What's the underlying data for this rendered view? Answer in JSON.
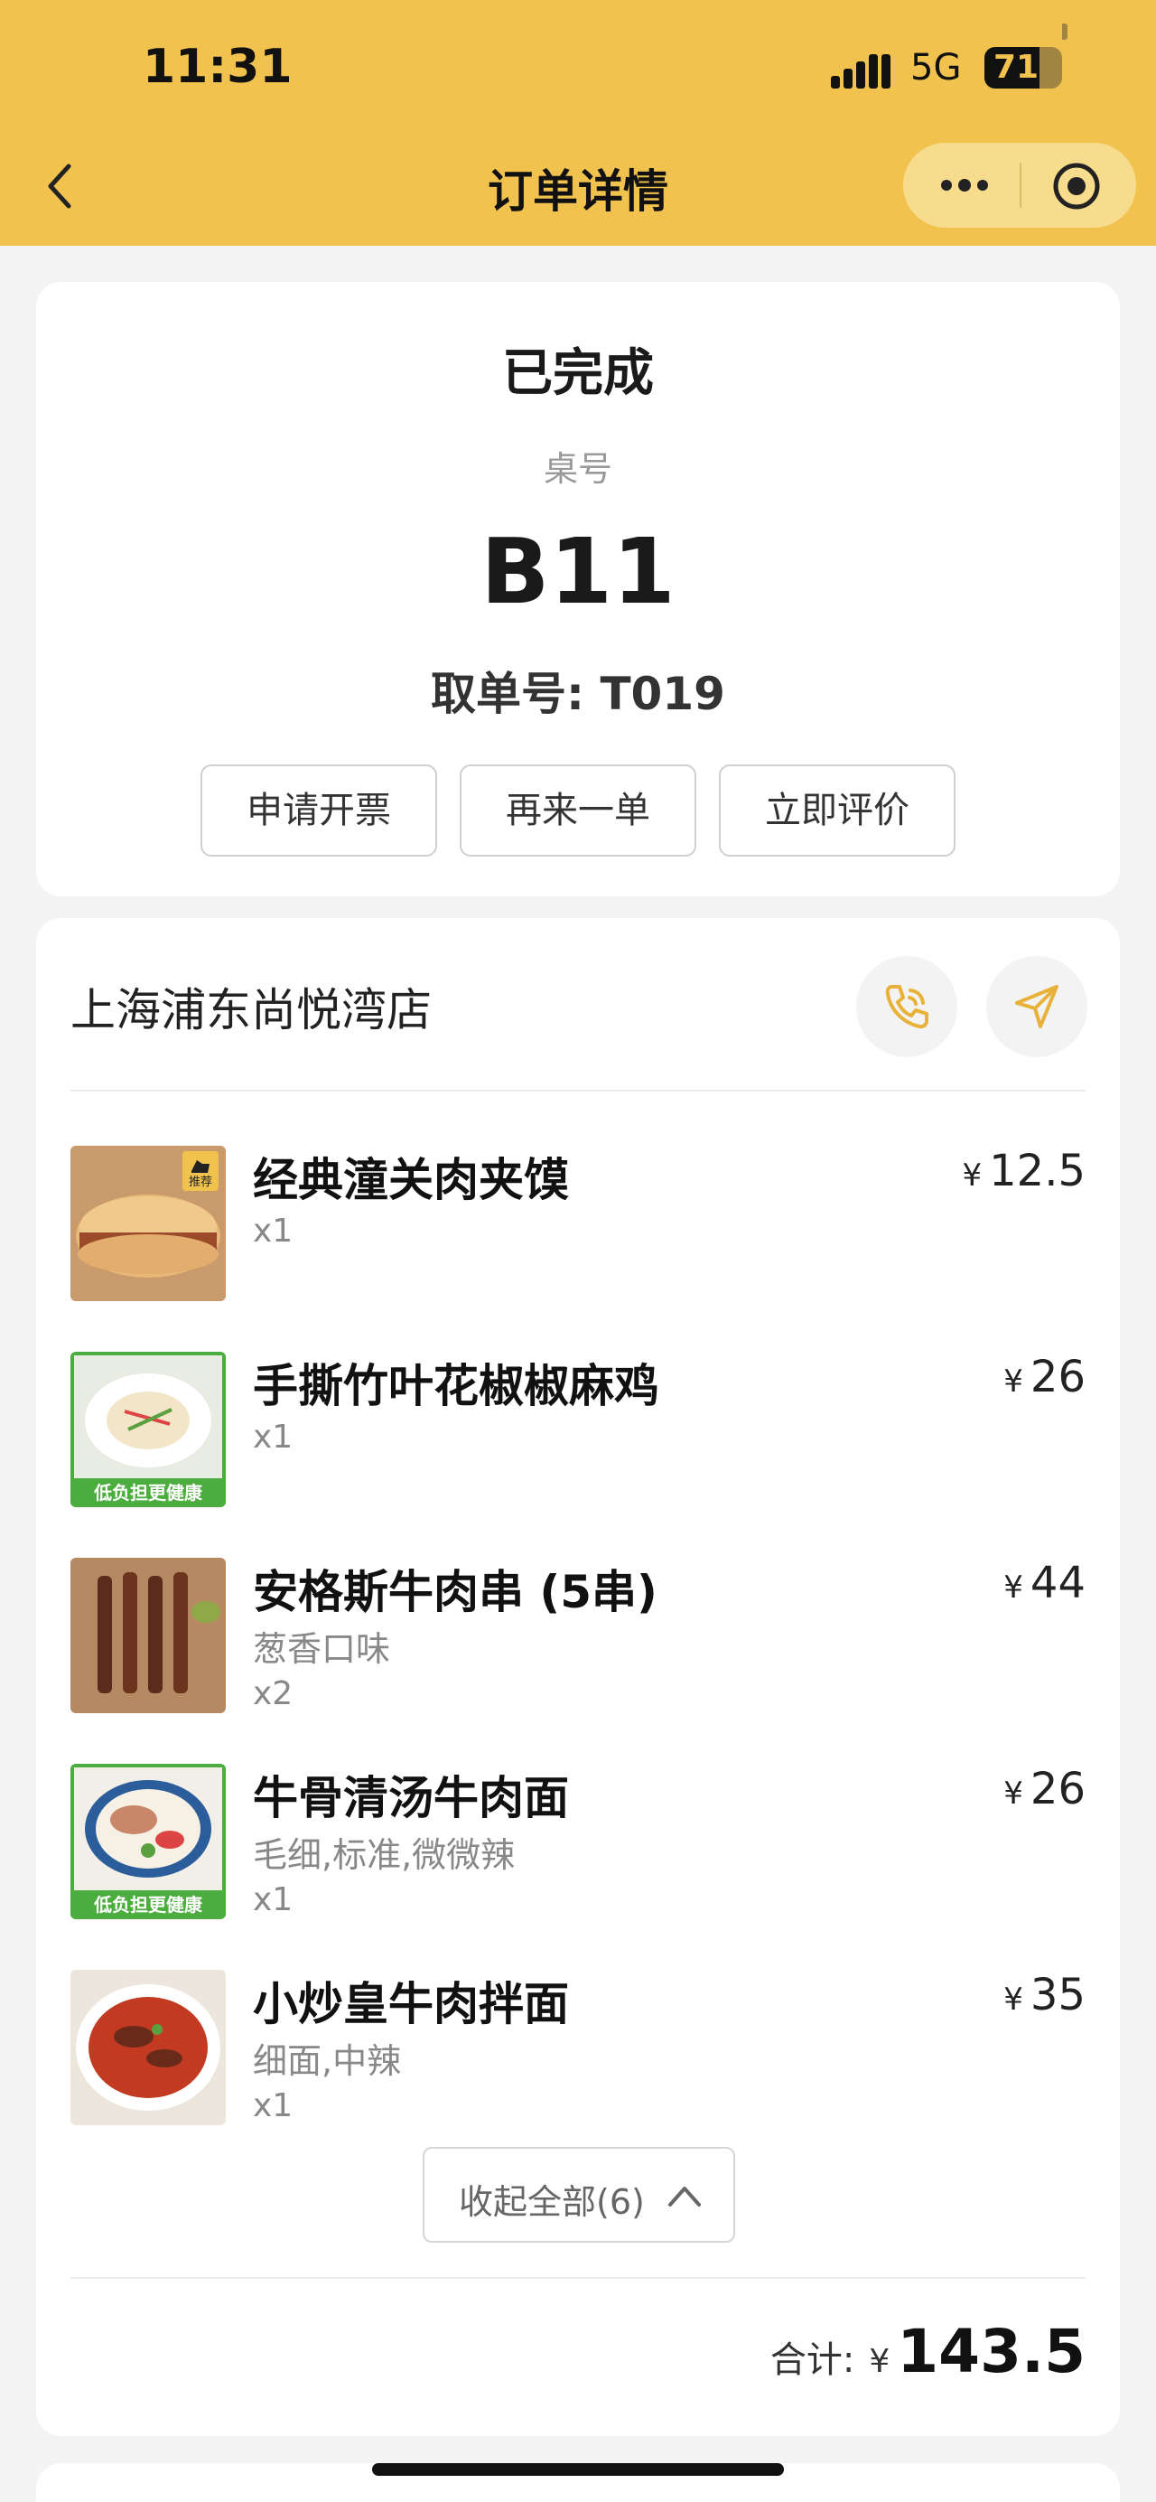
{
  "status_bar": {
    "time": "11:31",
    "network": "5G",
    "battery_level": "71",
    "battery_fraction": 0.71
  },
  "nav": {
    "title": "订单详情"
  },
  "order": {
    "status": "已完成",
    "table_label": "桌号",
    "table_no": "B11",
    "pickup_label": "取单号: T019",
    "actions": [
      "申请开票",
      "再来一单",
      "立即评价"
    ]
  },
  "store": {
    "name": "上海浦东尚悦湾店"
  },
  "items": [
    {
      "name": "经典潼关肉夹馍",
      "options": "",
      "qty": "x1",
      "currency": "¥",
      "price": "12.5",
      "badge": "推荐"
    },
    {
      "name": "手撕竹叶花椒椒麻鸡",
      "options": "",
      "qty": "x1",
      "currency": "¥",
      "price": "26",
      "banner": "低负担更健康"
    },
    {
      "name": "安格斯牛肉串 (5串)",
      "options": "葱香口味",
      "qty": "x2",
      "currency": "¥",
      "price": "44"
    },
    {
      "name": "牛骨清汤牛肉面",
      "options": "毛细,标准,微微辣",
      "qty": "x1",
      "currency": "¥",
      "price": "26",
      "banner": "低负担更健康"
    },
    {
      "name": "小炒皇牛肉拌面",
      "options": "细面,中辣",
      "qty": "x1",
      "currency": "¥",
      "price": "35"
    }
  ],
  "collapse_label": "收起全部(6)",
  "total": {
    "label": "合计:",
    "currency": "¥",
    "amount": "143.5"
  },
  "colors": {
    "brand_yellow": "#f2c24f",
    "accent_yellow": "#e8b23a"
  }
}
